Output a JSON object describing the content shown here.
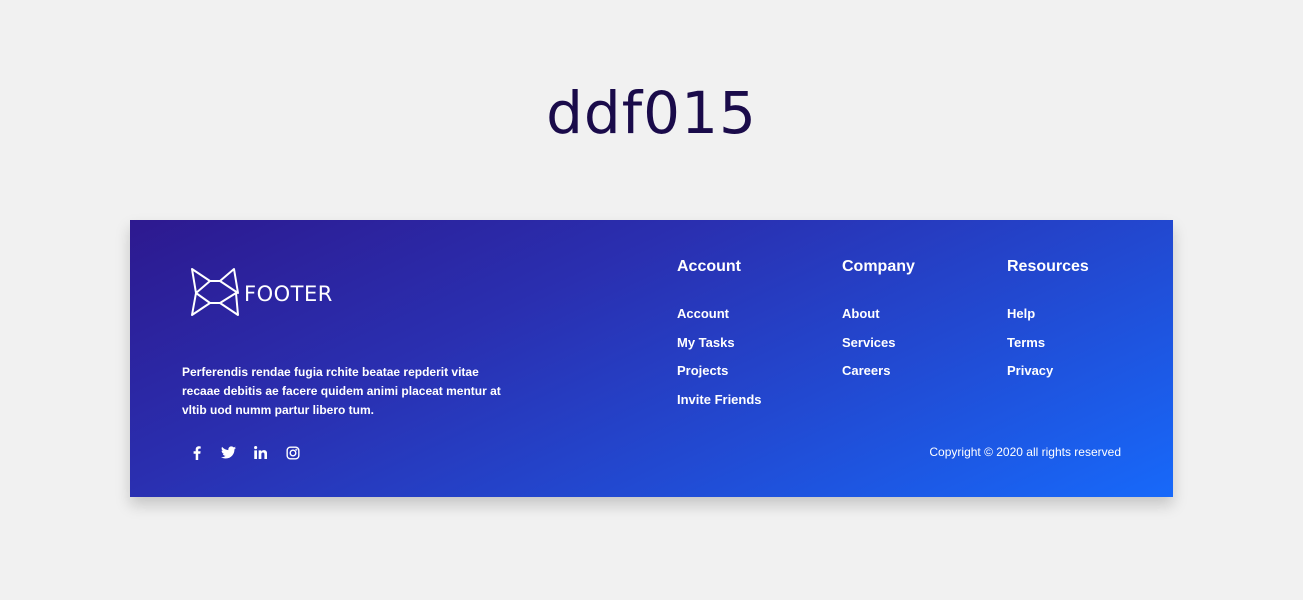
{
  "page": {
    "title": "ddf015"
  },
  "footer": {
    "brand": {
      "logo_icon": "triangles-logo-icon",
      "name": "FOOTER"
    },
    "description": "Perferendis rendae fugia rchite beatae repderit vitae recaae debitis ae facere quidem animi placeat mentur at vltib uod numm partur libero tum.",
    "social": [
      {
        "icon": "facebook-icon"
      },
      {
        "icon": "twitter-icon"
      },
      {
        "icon": "linkedin-icon"
      },
      {
        "icon": "instagram-icon"
      }
    ],
    "columns": [
      {
        "title": "Account",
        "links": [
          "Account",
          "My Tasks",
          "Projects",
          "Invite Friends"
        ]
      },
      {
        "title": "Company",
        "links": [
          "About",
          "Services",
          "Careers"
        ]
      },
      {
        "title": "Resources",
        "links": [
          "Help",
          "Terms",
          "Privacy"
        ]
      }
    ],
    "copyright": "Copyright © 2020 all rights reserved",
    "colors": {
      "gradient_start": "#2d198f",
      "gradient_end": "#1769fa",
      "page_background": "#f1f1f1",
      "title_color": "#1a0b4a"
    }
  }
}
